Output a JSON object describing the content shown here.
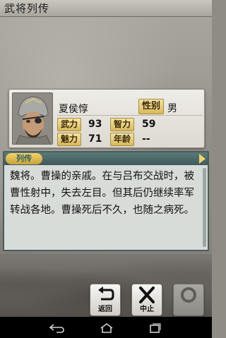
{
  "app": {
    "title": "武将列传"
  },
  "character": {
    "name": "夏侯惇",
    "gender_label": "性别",
    "gender": "男",
    "stats": [
      {
        "label": "武力",
        "value": "93"
      },
      {
        "label": "智力",
        "value": "59"
      },
      {
        "label": "魅力",
        "value": "71"
      },
      {
        "label": "年龄",
        "value": "--"
      }
    ]
  },
  "biography": {
    "tab_label": "列传",
    "text": "魏将。曹操的亲戚。在与吕布交战时，被曹性射中，失去左目。但其后仍继续率军转战各地。曹操死后不久，也随之病死。"
  },
  "buttons": {
    "back_label": "返回",
    "stop_label": "中止"
  },
  "nav": {
    "icons": [
      "back-icon",
      "home-icon",
      "recent-apps-icon"
    ]
  },
  "colors": {
    "label_gold": "#d9b85c",
    "panel_teal": "#4a5c5c",
    "text_dark": "#111111"
  }
}
